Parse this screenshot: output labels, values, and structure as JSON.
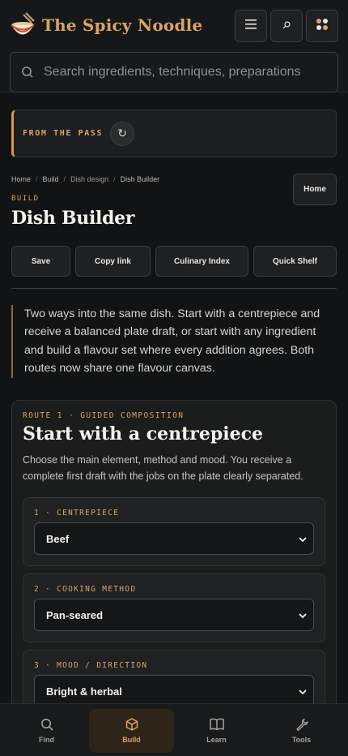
{
  "header": {
    "brand_title": "The Spicy Noodle",
    "menu_icon": "hamburger-icon",
    "search_icon": "search-icon",
    "apps_icon": "apps-grid-icon"
  },
  "search": {
    "placeholder": "Search ingredients, techniques, preparations"
  },
  "pass": {
    "label": "FROM THE PASS",
    "refresh_icon": "refresh-icon"
  },
  "breadcrumb": {
    "items": [
      "Home",
      "Build",
      "Dish design",
      "Dish Builder"
    ]
  },
  "home_button": "Home",
  "page": {
    "eyebrow": "BUILD",
    "title": "Dish Builder"
  },
  "actions": {
    "save": "Save",
    "copy_link": "Copy link",
    "culinary_index": "Culinary Index",
    "quick_shelf": "Quick Shelf"
  },
  "intro": "Two ways into the same dish. Start with a centrepiece and receive a balanced plate draft, or start with any ingredient and build a flavour set where every addition agrees. Both routes now share one flavour canvas.",
  "route1": {
    "eyebrow": "ROUTE 1 · GUIDED COMPOSITION",
    "title": "Start with a centrepiece",
    "description": "Choose the main element, method and mood. You receive a complete first draft with the jobs on the plate clearly separated.",
    "fields": [
      {
        "label": "1 · CENTREPIECE",
        "value": "Beef"
      },
      {
        "label": "2 · COOKING METHOD",
        "value": "Pan-seared"
      },
      {
        "label": "3 · MOOD / DIRECTION",
        "value": "Bright & herbal"
      }
    ]
  },
  "nav": {
    "find": "Find",
    "build": "Build",
    "learn": "Learn",
    "tools": "Tools",
    "active": "Build"
  },
  "colors": {
    "accent": "#d9a464",
    "background": "#121314",
    "active_nav": "#2f2418"
  }
}
